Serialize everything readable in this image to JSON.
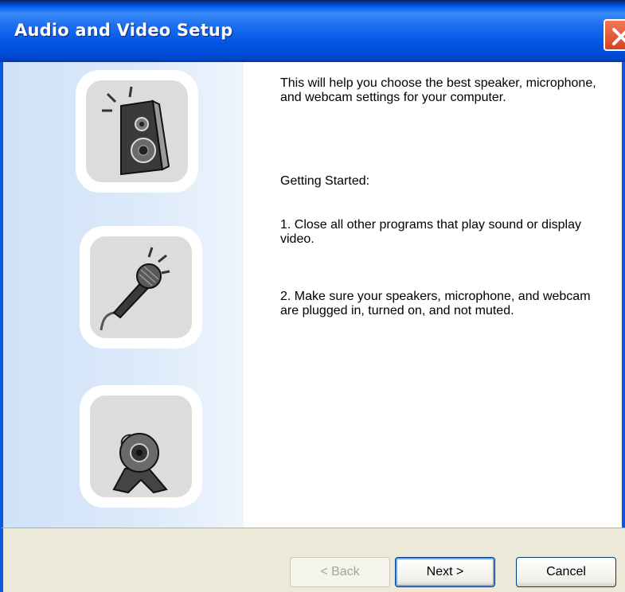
{
  "window": {
    "title": "Audio and Video Setup"
  },
  "icons": [
    "speaker-icon",
    "microphone-icon",
    "webcam-icon"
  ],
  "content": {
    "intro": "This will help you choose the best speaker, microphone, and webcam settings for your computer.",
    "getting_started": "Getting Started:",
    "step1": "1. Close all other programs that play sound or display video.",
    "step2": "2. Make sure your speakers, microphone, and webcam are plugged in, turned on, and not muted."
  },
  "buttons": {
    "back": "< Back",
    "next": "Next >",
    "cancel": "Cancel"
  },
  "colors": {
    "title_bar": "#0055e5",
    "close_button": "#e0522b",
    "panel": "#dbe9f9",
    "footer": "#ece9d8"
  }
}
